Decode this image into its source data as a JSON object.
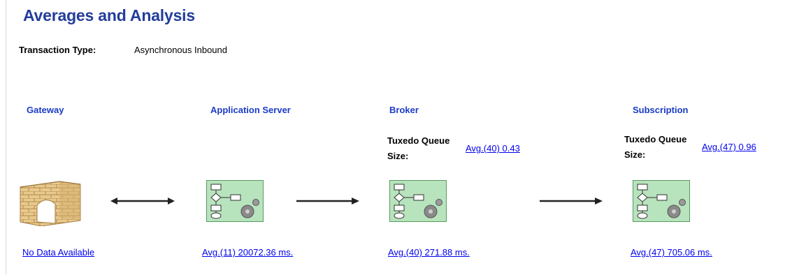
{
  "page": {
    "title": "Averages and Analysis"
  },
  "transaction": {
    "label": "Transaction Type:",
    "value": "Asynchronous Inbound"
  },
  "stages": {
    "gateway": {
      "title": "Gateway",
      "link": "No Data Available",
      "icon": "brick-wall-icon"
    },
    "app_server": {
      "title": "Application Server",
      "link": "Avg.(11) 20072.36 ms.",
      "icon": "process-flow-icon"
    },
    "broker": {
      "title": "Broker",
      "queue_label_line1": "Tuxedo Queue",
      "queue_label_line2": "Size:",
      "queue_link": "Avg.(40) 0.43",
      "link": "Avg.(40) 271.88 ms.",
      "icon": "process-flow-icon"
    },
    "subscription": {
      "title": "Subscription",
      "queue_label_line1": "Tuxedo Queue",
      "queue_label_line2": "Size:",
      "queue_link": "Avg.(47) 0.96",
      "link": "Avg.(47) 705.06 ms.",
      "icon": "process-flow-icon"
    }
  },
  "connectors": [
    "double-arrow-icon",
    "arrow-right-icon",
    "arrow-right-icon"
  ],
  "colors": {
    "title": "#233d9b",
    "stage_title": "#1a3bc6",
    "link": "#0000ee",
    "node_bg": "#b7e3bd"
  }
}
